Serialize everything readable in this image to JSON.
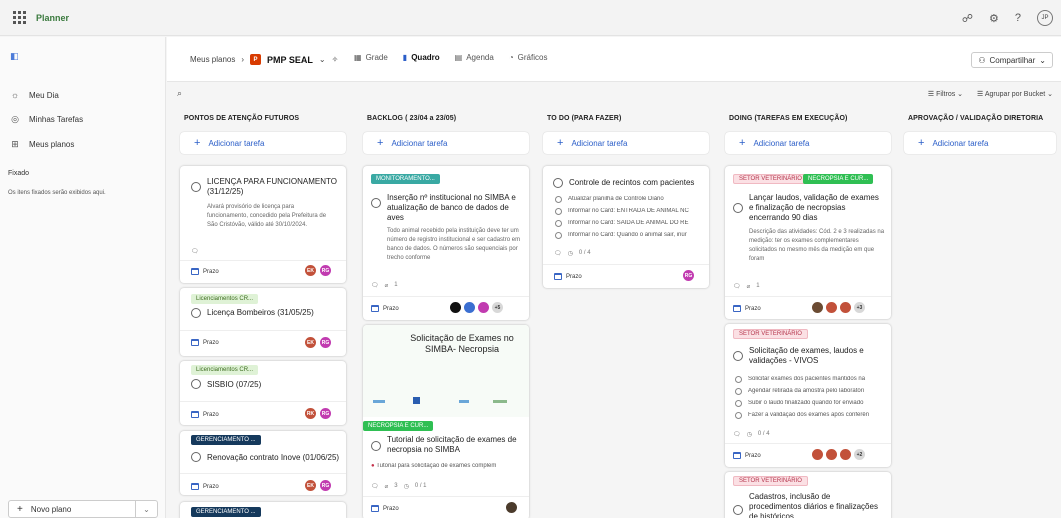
{
  "app": {
    "name": "Planner",
    "user_initials": "JP"
  },
  "nav": {
    "items": [
      {
        "label": "Meu Dia"
      },
      {
        "label": "Minhas Tarefas"
      },
      {
        "label": "Meus planos"
      }
    ],
    "pinned_title": "Fixado",
    "pinned_text": "Os itens fixados serão exibidos aqui.",
    "new_plan": "Novo plano"
  },
  "plan": {
    "breadcrumb": "Meus planos",
    "badge": "P",
    "name": "PMP SEAL",
    "views": [
      "Grade",
      "Quadro",
      "Agenda",
      "Gráficos"
    ],
    "share": "Compartilhar",
    "filters": "Filtros",
    "group_by": "Agrupar por Bucket"
  },
  "add_task_label": "Adicionar tarefa",
  "prazo_label": "Prazo",
  "columns": [
    {
      "title": "PONTOS DE ATENÇÃO FUTUROS"
    },
    {
      "title": "BACKLOG ( 23/04 a 23/05)"
    },
    {
      "title": "TO DO (PARA FAZER)"
    },
    {
      "title": "DOING (TAREFAS EM EXECUÇÃO)"
    },
    {
      "title": "APROVAÇÃO / VALIDAÇÃO DIRETORIA"
    }
  ],
  "cards": {
    "c1": {
      "title": "LICENÇA PARA FUNCIONAMENTO (31/12/25)",
      "desc": "Alvará provisório de licença para funcionamento, concedido pela Prefeitura de São Cristóvão, válido até 30/10/2024.",
      "avatars": [
        "EK",
        "RG"
      ]
    },
    "c2": {
      "tag": "Licenciamentos CR...",
      "title": "Licença Bombeiros (31/05/25)",
      "avatars": [
        "EK",
        "RG"
      ]
    },
    "c3": {
      "tag": "Licenciamentos CR...",
      "title": "SISBIO (07/25)",
      "avatars": [
        "RK",
        "RG"
      ]
    },
    "c4": {
      "tag": "GERENCIAMENTO ...",
      "title": "Renovação contrato Inove (01/06/25)",
      "avatars": [
        "EK",
        "RG"
      ]
    },
    "c5": {
      "tag": "GERENCIAMENTO ..."
    },
    "b1": {
      "tag": "MONITORAMENTO...",
      "title": "Inserção nº institucional no SIMBA e atualização de banco de dados de aves",
      "desc": "Todo animal recebido pela instituição deve ter um número de registro institucional e ser cadastro em banco de dados. O números são sequenciais por trecho conforme",
      "meta": "1",
      "more": "+5"
    },
    "b2": {
      "image_title": "Solicitação de Exames no SIMBA- Necropsia",
      "tag": "NECROPSIA E CUR...",
      "title": "Tutorial de solicitação de exames de necropsia no SIMBA",
      "attachment": "Tutorial para solicitação de exames complem",
      "meta": "3",
      "checklist": "0 / 1"
    },
    "t1": {
      "title": "Controle de recintos com pacientes",
      "checks": [
        "Atualizar planilha de Controle Diário",
        "Informar no Card: ENTRADA DE ANIMAL NC",
        "Informar no Card: SAÍDA DE ANIMAL DO RE",
        "Informar no Card: Quando o animal sair, inür"
      ],
      "checklist": "0 / 4",
      "avatars": [
        "RG"
      ]
    },
    "d1": {
      "tags": [
        "SETOR VETERINÁRIO",
        "NECROPSIA E CUR..."
      ],
      "title": "Lançar laudos, validação de exames e finalização de necropsias encerrando 90 dias",
      "desc": "Descrição das atividades: Cód. 2 e 3 realizadas na medição: ter os exames complementares solicitados no mesmo mês da medição em que foram",
      "meta": "1",
      "more": "+3"
    },
    "d2": {
      "tag": "SETOR VETERINÁRIO",
      "title": "Solicitação de exames, laudos e validações - VIVOS",
      "checks": [
        "Solicitar exames dos pacientes mantidos na",
        "Agendar retirada da amostra pelo laboratóri",
        "Subir o laudo finalizado quando for enviado",
        "Fazer a validação dos exames após conferên"
      ],
      "checklist": "0 / 4",
      "more": "+2"
    },
    "d3": {
      "tag": "SETOR VETERINÁRIO",
      "title": "Cadastros, inclusão de procedimentos diários e finalizações de históricos"
    }
  },
  "colors": {
    "accent": "#2b5ec8",
    "brand": "#3b7a3e",
    "badge": "#d83b01"
  }
}
